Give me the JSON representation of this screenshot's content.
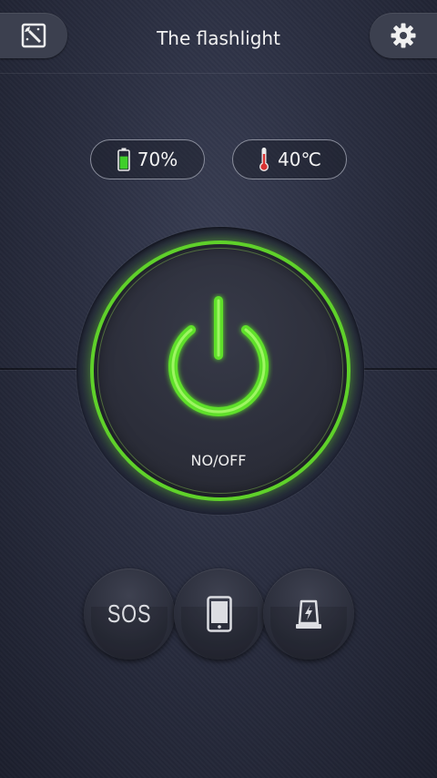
{
  "header": {
    "title": "The flashlight",
    "left_icon": "image-wand-icon",
    "right_icon": "gear-icon"
  },
  "status": {
    "battery_text": "70%",
    "battery_level": 0.7,
    "temperature_text": "40℃"
  },
  "power": {
    "label": "NO/OFF",
    "accent_color": "#5fd12a"
  },
  "modes": {
    "sos_label": "SOS",
    "screen_icon": "phone-screen-icon",
    "warning_icon": "warning-light-icon"
  }
}
